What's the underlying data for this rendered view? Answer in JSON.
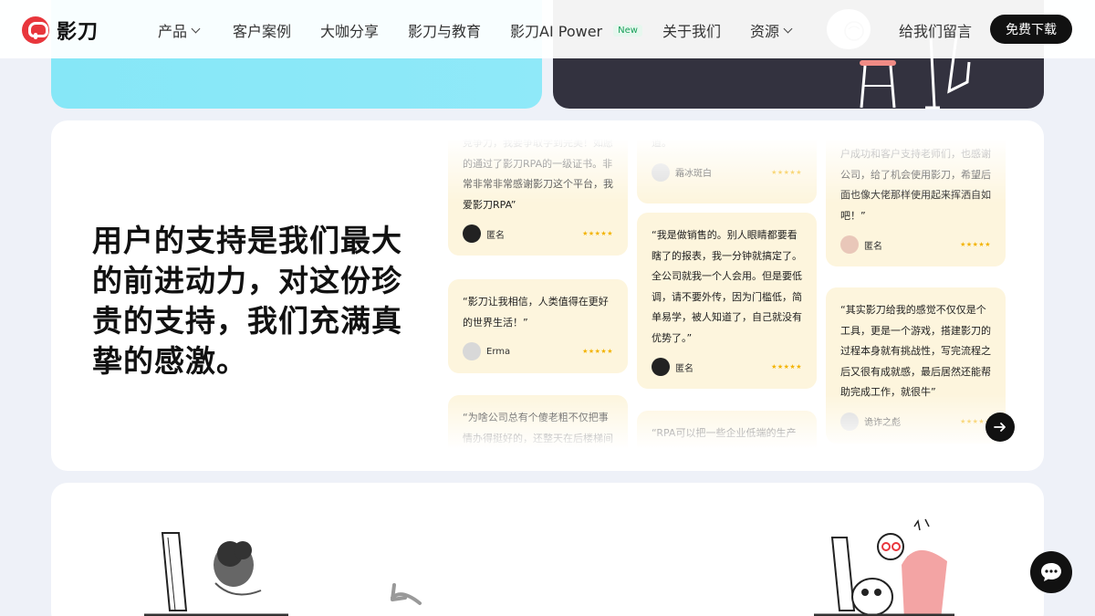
{
  "brand": {
    "name": "影刀",
    "accent": "#e8363c"
  },
  "nav": {
    "items": [
      {
        "label": "产品",
        "has_dropdown": true
      },
      {
        "label": "客户案例"
      },
      {
        "label": "大咖分享"
      },
      {
        "label": "影刀与教育"
      },
      {
        "label": "影刀AI Power",
        "badge": "New"
      },
      {
        "label": "关于我们"
      },
      {
        "label": "资源",
        "has_dropdown": true
      }
    ],
    "message_link": "给我们留言",
    "download_button": "免费下载"
  },
  "testimonials": {
    "headline": "用户的支持是我们最大的前进动力，对这份珍贵的支持，我们充满真挚的感激。",
    "reviews": [
      {
        "text": "竞争力，我要争取学到完美！如愿的通过了影刀RPA的一级证书。非常非常非常感谢影刀这个平台，我爱影刀RPA”",
        "author": "匿名",
        "stars": "★★★★★",
        "avatar": "dark"
      },
      {
        "text": "“影刀让我相信，人类值得在更好的世界生活！”",
        "author": "Erma",
        "stars": "★★★★★",
        "avatar": "light"
      },
      {
        "text": "“为啥公司总有个傻老粗不仅把事情办得挺好的，还整天在后楼梯间",
        "author": "",
        "stars": "",
        "avatar": ""
      },
      {
        "text": "道。",
        "author": "霜冰斑白",
        "stars": "★★★★★",
        "avatar": "light"
      },
      {
        "text": "“我是做销售的。别人眼睛都要看瞎了的报表，我一分钟就搞定了。全公司就我一个人会用。但是要低调，请不要外传，因为门槛低，简单易学，被人知道了，自己就没有优势了。”",
        "author": "匿名",
        "stars": "★★★★★",
        "avatar": "dark"
      },
      {
        "text": "“RPA可以把一些企业低端的生产",
        "author": "",
        "stars": "",
        "avatar": ""
      },
      {
        "text": "户成功和客户支持老师们，也感谢公司，给了机会使用影刀，希望后面也像大佬那样使用起来挥洒自如吧！”",
        "author": "匿名",
        "stars": "★★★★★",
        "avatar": "pink"
      },
      {
        "text": "“其实影刀给我的感觉不仅仅是个工具，更是一个游戏，搭建影刀的过程本身就有挑战性，写完流程之后又很有成就感，最后居然还能帮助完成工作，就很牛”",
        "author": "诡诈之彪",
        "stars": "★★★★★",
        "avatar": "light"
      }
    ]
  },
  "icons": {
    "next": "arrow-right-icon",
    "chat": "chat-bubble-icon",
    "dropdown": "chevron-down-icon"
  }
}
